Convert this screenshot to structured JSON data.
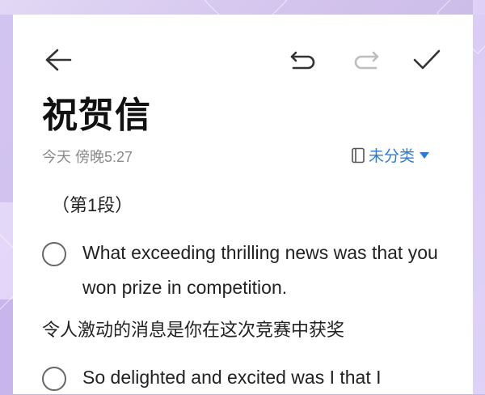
{
  "note": {
    "title": "祝贺信",
    "meta": "今天 傍晚5:27",
    "category_label": "未分类",
    "section_label": "（第1段）",
    "items": [
      {
        "text": "What exceeding thrilling news was that you won prize in competition."
      },
      {
        "text": "So delighted and excited was I that I"
      }
    ],
    "translation_line": "令人激动的消息是你在这次竞赛中获奖"
  },
  "toolbar": {
    "back_icon": "back-arrow-icon",
    "undo_icon": "undo-icon",
    "redo_icon": "redo-icon",
    "done_icon": "checkmark-icon",
    "redo_disabled": true
  },
  "colors": {
    "accent": "#2b7bd6",
    "text": "#222222",
    "meta": "#8a8a8a",
    "background": "#c7b4e6"
  }
}
